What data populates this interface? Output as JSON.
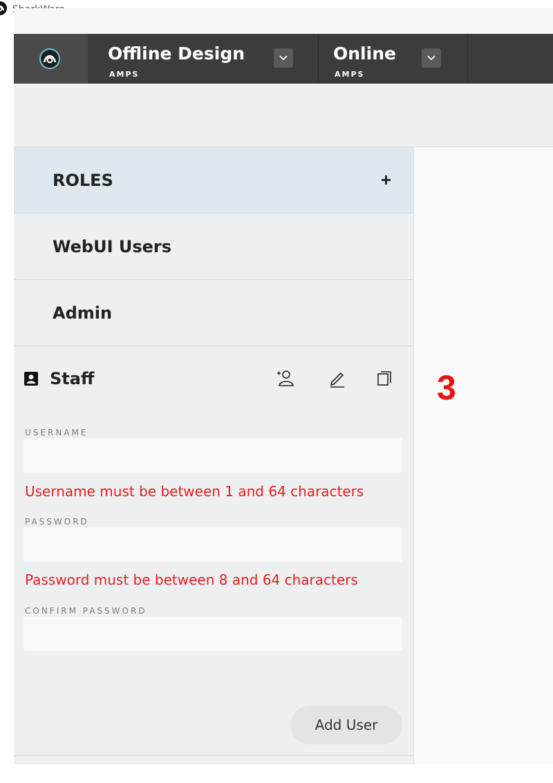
{
  "app": {
    "name": "SharkWare"
  },
  "nav": {
    "groups": [
      {
        "title": "Offline Design",
        "sub": "AMPS"
      },
      {
        "title": "Online",
        "sub": "AMPS"
      }
    ]
  },
  "sidebar": {
    "items": [
      {
        "label": "ROLES",
        "action": "+"
      },
      {
        "label": "WebUI Users"
      },
      {
        "label": "Admin"
      }
    ],
    "staff": {
      "title": "Staff",
      "icons": [
        "add-user-icon",
        "edit-icon",
        "copy-icon"
      ],
      "form": {
        "username_label": "USERNAME",
        "username_value": "",
        "username_error": "Username must be between 1 and 64 characters",
        "password_label": "PASSWORD",
        "password_value": "",
        "password_error": "Password must be between 8 and 64 characters",
        "confirm_label": "CONFIRM PASSWORD",
        "confirm_value": "",
        "submit_label": "Add User"
      }
    }
  },
  "annotation": {
    "marker": "3"
  },
  "colors": {
    "nav_bg": "#3c3c3c",
    "error": "#e02020",
    "roles_highlight": "#dfe8ef"
  }
}
